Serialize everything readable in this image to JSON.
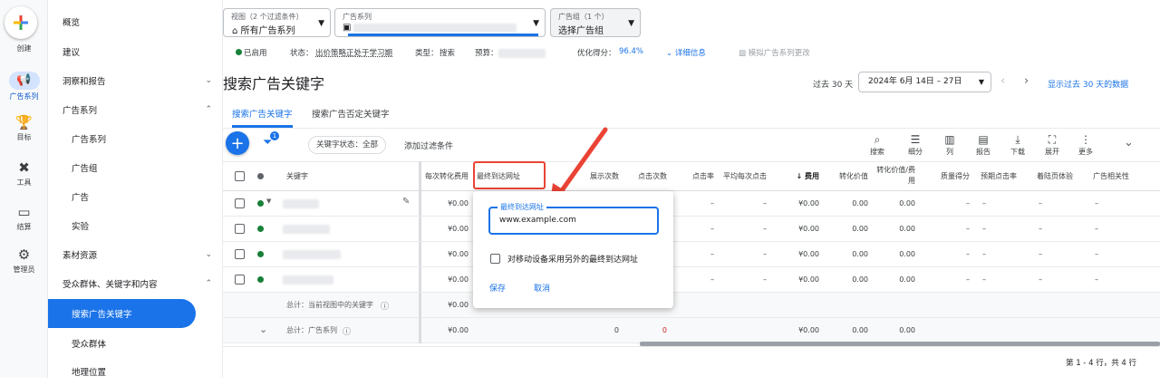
{
  "rail": {
    "create": "创建",
    "items": [
      {
        "label": "广告系列",
        "icon": "megaphone-icon"
      },
      {
        "label": "目标",
        "icon": "trophy-icon"
      },
      {
        "label": "工具",
        "icon": "tools-icon"
      },
      {
        "label": "结算",
        "icon": "card-icon"
      },
      {
        "label": "管理员",
        "icon": "gear-icon"
      }
    ]
  },
  "nav": {
    "items": [
      "概览",
      "建议",
      "洞察和报告",
      "广告系列",
      "广告系列",
      "广告组",
      "广告",
      "实验",
      "素材资源",
      "受众群体、关键字和内容",
      "搜索广告关键字",
      "受众群体",
      "地理位置"
    ]
  },
  "topbar": {
    "view_small": "视图（2 个过滤条件）",
    "view_main": "所有广告系列",
    "campaign_small": "广告系列",
    "adgroup_small": "广告组（1 个）",
    "adgroup_main": "选择广告组"
  },
  "status": {
    "enabled": "已启用",
    "status_label": "状态：",
    "status_value": "出价策略正处于学习期",
    "type_label": "类型：",
    "type_value": "搜索",
    "budget_label": "预算：",
    "opt_label": "优化得分：",
    "opt_value": "96.4%",
    "details": "详细信息",
    "simulate": "模拟广告系列更改"
  },
  "page": {
    "title": "搜索广告关键字",
    "range_prefix": "过去 30 天",
    "range_value": "2024年 6月 14日 – 27日",
    "show_last": "显示过去 30 天的数据",
    "tabs": [
      "搜索广告关键字",
      "搜索广告否定关键字"
    ],
    "filter_chip": "关键字状态：全部",
    "add_filter": "添加过滤条件",
    "filter_badge": "1"
  },
  "toolbar": [
    "搜索",
    "细分",
    "列",
    "报告",
    "下载",
    "展开",
    "更多"
  ],
  "columns": [
    "关键字",
    "每次转化费用",
    "最终到达网址",
    "展示次数",
    "点击次数",
    "点击率",
    "平均每次点击",
    "费用",
    "转化价值",
    "转化价值/费用",
    "质量得分",
    "预期点击率",
    "着陆页体验",
    "广告相关性"
  ],
  "rows": [
    {
      "cpa": "¥0.00",
      "cost": "¥0.00",
      "conv": "0.00",
      "roas": "0.00"
    },
    {
      "cpa": "¥0.00",
      "cost": "¥0.00",
      "conv": "0.00",
      "roas": "0.00"
    },
    {
      "cpa": "¥0.00",
      "cost": "¥0.00",
      "conv": "0.00",
      "roas": "0.00"
    },
    {
      "cpa": "¥0.00",
      "cost": "¥0.00",
      "conv": "0.00",
      "roas": "0.00"
    }
  ],
  "totals": {
    "view_label": "总计：当前视图中的关键字",
    "campaign_label": "总计：广告系列",
    "cpa": "¥0.00",
    "impr": "0",
    "clicks": "0",
    "cost": "¥0.00",
    "conv": "0.00",
    "roas": "0.00"
  },
  "dash": "–",
  "popup": {
    "field_label": "最终到达网址",
    "field_value": "www.example.com",
    "mobile_checkbox": "对移动设备采用另外的最终到达网址",
    "save": "保存",
    "cancel": "取消"
  },
  "footer": "第 1 - 4 行，共 4 行"
}
